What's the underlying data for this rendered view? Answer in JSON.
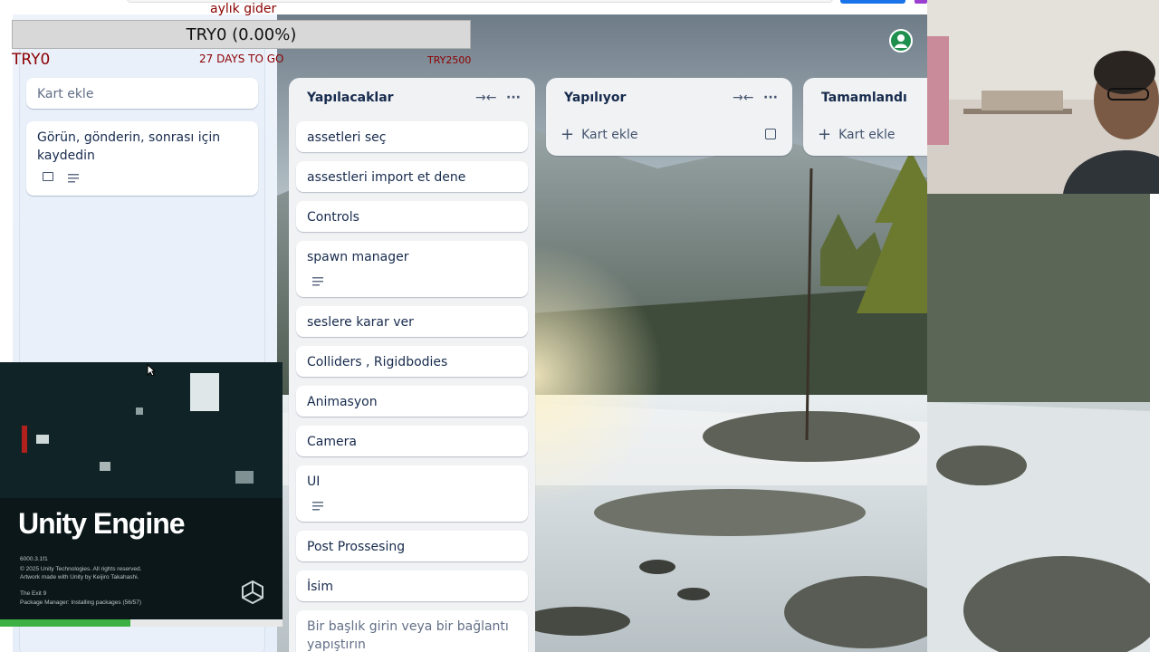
{
  "gider": {
    "title": "aylık gider",
    "progress_text": "TRY0 (0.00%)",
    "current": "TRY0",
    "days_to_go": "27 DAYS TO GO",
    "target": "TRY2500"
  },
  "left_list": {
    "add_card": "Kart ekle",
    "cards": [
      {
        "text": "Görün, gönderin, sonrası için kaydedin"
      }
    ]
  },
  "lists": [
    {
      "title": "Yapılacaklar",
      "cards": [
        {
          "text": "assetleri seç"
        },
        {
          "text": "assestleri import et dene"
        },
        {
          "text": "Controls"
        },
        {
          "text": "spawn manager"
        },
        {
          "text": "seslere karar ver"
        },
        {
          "text": "Colliders , Rigidbodies"
        },
        {
          "text": "Animasyon"
        },
        {
          "text": "Camera"
        },
        {
          "text": "UI"
        },
        {
          "text": "Post Prossesing"
        },
        {
          "text": "İsim"
        }
      ],
      "composer_placeholder": "Bir başlık girin veya bir bağlantı yapıştırın"
    },
    {
      "title": "Yapılıyor",
      "add_card": "Kart ekle"
    },
    {
      "title": "Tamamlandı",
      "add_card": "Kart ekle"
    }
  ],
  "unity_splash": {
    "title": "Unity Engine",
    "version": "6000.3.1f1",
    "copyright": "© 2025 Unity Technologies. All rights reserved.",
    "artwork": "Artwork made with Unity by Keijiro Takahashi.",
    "project": "The Exit 9",
    "status": "Package Manager: Installing packages (56/57)",
    "progress_fraction": 0.46
  },
  "icons": {
    "collapse": "collapse-arrows-icon",
    "more": "ellipsis-icon",
    "plus": "plus-icon",
    "template": "card-template-icon",
    "email": "email-icon",
    "description": "description-icon",
    "unity_logo": "unity-cube-icon",
    "user": "user-avatar-icon"
  },
  "colors": {
    "list_bg": "#f1f2f4",
    "card_bg": "#ffffff",
    "text": "#172b4d",
    "gider_text": "#8b0000",
    "unity_progress": "#3cb043"
  }
}
